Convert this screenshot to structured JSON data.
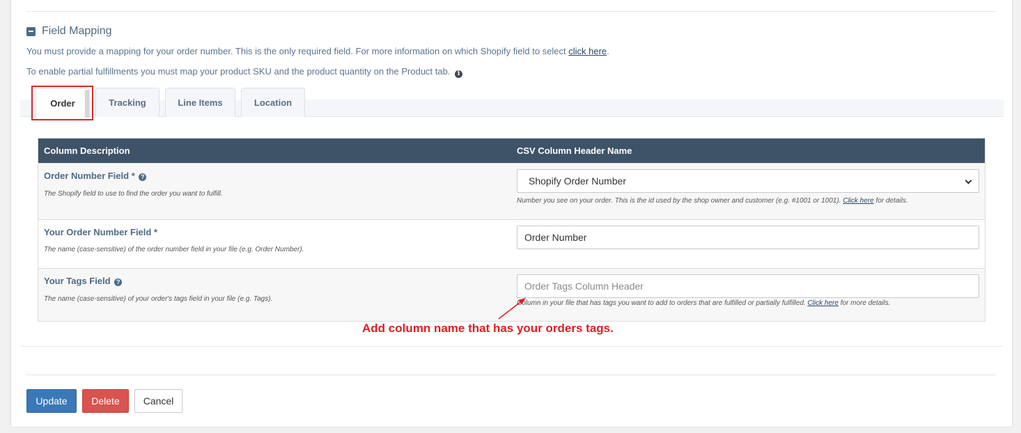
{
  "section": {
    "title": "Field Mapping",
    "help_prefix": "You must provide a mapping for your order number. This is the only required field. For more information on which Shopify field to select ",
    "help_link": "click here",
    "help_suffix": ".",
    "partial_note": "To enable partial fulfillments you must map your product SKU and the product quantity on the Product tab."
  },
  "tabs": [
    {
      "label": "Order",
      "active": true
    },
    {
      "label": "Tracking",
      "active": false
    },
    {
      "label": "Line Items",
      "active": false
    },
    {
      "label": "Location",
      "active": false
    }
  ],
  "table": {
    "headers": [
      "Column Description",
      "CSV Column Header Name"
    ],
    "rows": [
      {
        "label": "Order Number Field *",
        "description": "The Shopify field to use to find the order you want to fulfill.",
        "control_type": "select",
        "value": "Shopify Order Number",
        "hint_prefix": "Number you see on your order. This is the id used by the shop owner and customer (e.g. #1001 or 1001). ",
        "hint_link": "Click here",
        "hint_suffix": " for details."
      },
      {
        "label": "Your Order Number Field *",
        "description": "The name (case-sensitive) of the order number field in your file (e.g. Order Number).",
        "control_type": "text",
        "value": "Order Number"
      },
      {
        "label": "Your Tags Field",
        "description": "The name (case-sensitive) of your order's tags field in your file (e.g. Tags).",
        "control_type": "text",
        "value": "",
        "placeholder": "Order Tags Column Header",
        "hint_prefix": "Column in your file that has tags you want to add to orders that are fulfilled or partially fulfilled. ",
        "hint_link": "Click here",
        "hint_suffix": " for more details."
      }
    ]
  },
  "annotation": {
    "text": "Add column name that has your orders tags.",
    "color": "#e01e1e"
  },
  "buttons": {
    "update": "Update",
    "delete": "Delete",
    "cancel": "Cancel"
  },
  "icons": {
    "collapse": "minus-square-icon",
    "info": "info-circle-icon",
    "help": "question-circle-icon",
    "dropdown": "chevron-down-icon"
  },
  "colors": {
    "table_header": "#3e5368",
    "primary": "#3a78b8",
    "danger": "#d9534f",
    "highlight": "#d62a2a"
  }
}
